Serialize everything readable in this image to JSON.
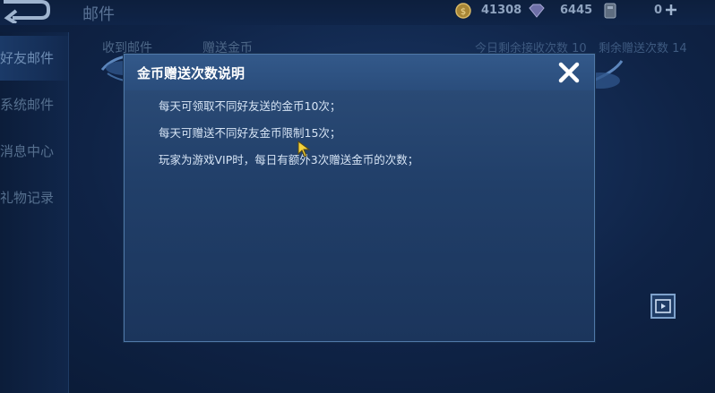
{
  "header": {
    "title": "邮件",
    "gold": "41308",
    "diamonds": "6445",
    "tickets": "0"
  },
  "sidebar": {
    "items": [
      {
        "label": "好友邮件"
      },
      {
        "label": "系统邮件"
      },
      {
        "label": "消息中心"
      },
      {
        "label": "礼物记录"
      }
    ]
  },
  "tabs": {
    "received": "收到邮件",
    "gift_coins": "赠送金币"
  },
  "counters": {
    "receive_remaining": "今日剩余接收次数 10",
    "gift_remaining": "剩余赠送次数 14"
  },
  "dialog": {
    "title": "金币赠送次数说明",
    "lines": [
      "每天可领取不同好友送的金币10次；",
      "每天可赠送不同好友金币限制15次；",
      "玩家为游戏VIP时，每日有额外3次赠送金币的次数；"
    ]
  },
  "colors": {
    "dialog_bg": "#213f69",
    "dialog_border": "#4f78a8",
    "gold_coin": "#c9a24a",
    "close_icon": "#ffffff"
  },
  "icons": [
    "back-arrow-icon",
    "gold-coin-icon",
    "diamond-icon",
    "ticket-icon",
    "plus-icon",
    "close-icon",
    "video-icon",
    "cursor-icon"
  ]
}
